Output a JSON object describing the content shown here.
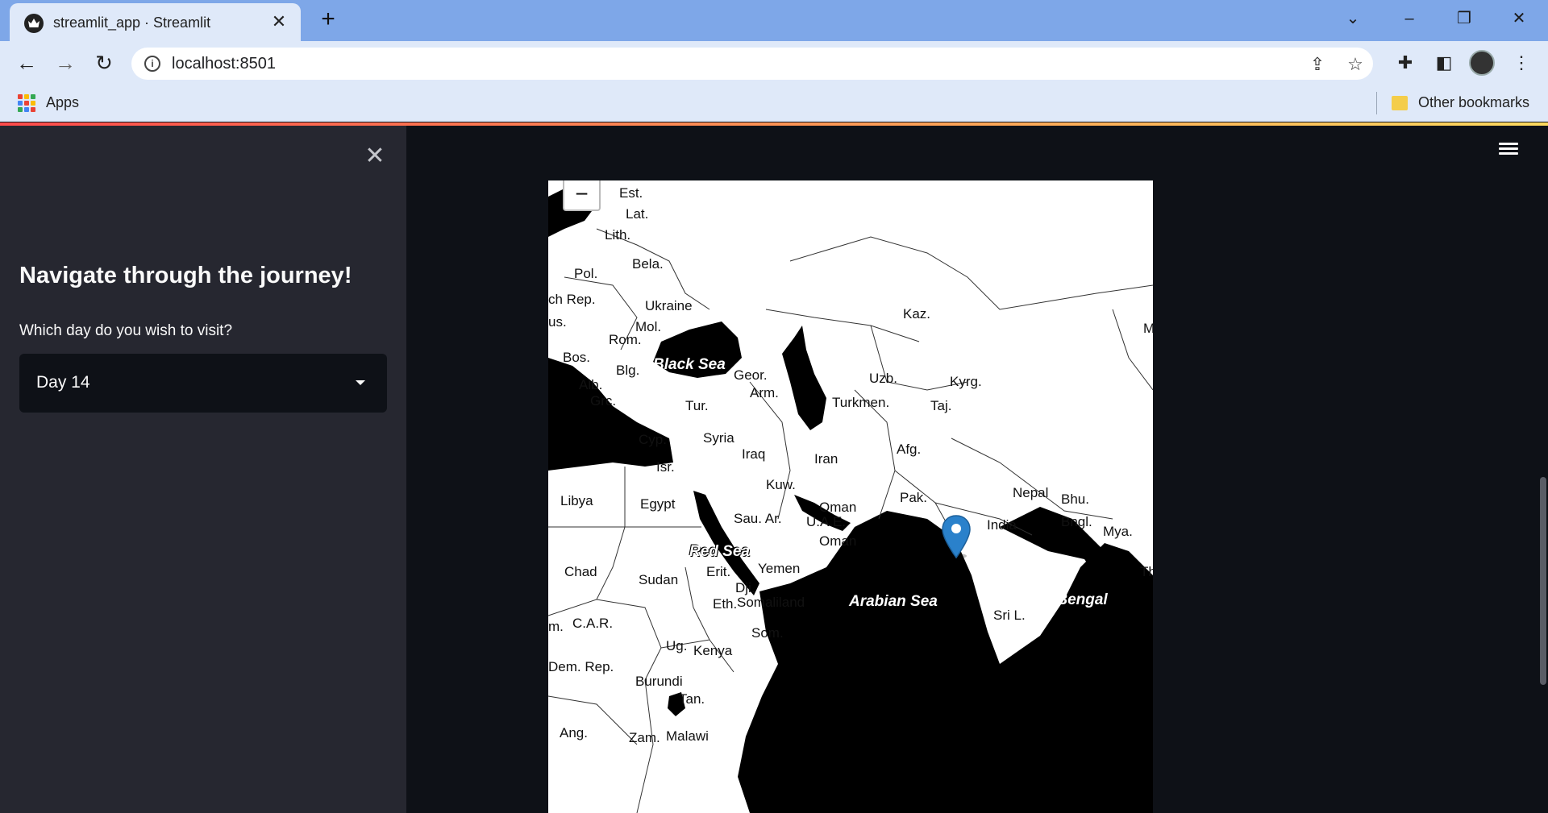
{
  "browser": {
    "tab_title": "streamlit_app · Streamlit",
    "new_tab_label": "+",
    "url": "localhost:8501",
    "bookmarks": {
      "apps_label": "Apps",
      "other_label": "Other bookmarks"
    }
  },
  "sidebar": {
    "close_glyph": "✕",
    "heading": "Navigate through the journey!",
    "select_label": "Which day do you wish to visit?",
    "select_value": "Day 14"
  },
  "map": {
    "zoom_out_glyph": "−",
    "country_labels": [
      "Est.",
      "Lat.",
      "Lith.",
      "Bela.",
      "Pol.",
      "ch Rep.",
      "Ukraine",
      "us.",
      "Mol.",
      "Rom.",
      "Bos.",
      "Blg.",
      "Alb.",
      "Grc.",
      "Geor.",
      "Arm.",
      "Tur.",
      "Kaz.",
      "Uzb.",
      "Kyrg.",
      "Turkmen.",
      "Taj.",
      "M",
      "Cyp.",
      "Syria",
      "Isr.",
      "Iraq",
      "Iran",
      "Afg.",
      "Libya",
      "Egypt",
      "Kuw.",
      "Oman",
      "U.A.E.",
      "Pak.",
      "Nepal",
      "Bhu.",
      "Sau. Ar.",
      "India",
      "Bngl.",
      "Mya.",
      "Oman",
      "Chad",
      "Sudan",
      "Erit.",
      "Yemen",
      "Tha",
      "Dji.",
      "Somaliland",
      "Eth.",
      "Sri L.",
      "m.",
      "C.A.R.",
      "Som.",
      "Ug.",
      "Kenya",
      "Dem. Rep.",
      "Burundi",
      "Tan.",
      "Ang.",
      "Zam.",
      "Malawi"
    ],
    "sea_labels": [
      "Black Sea",
      "Red Sea",
      "Arabian Sea",
      "Bay of Bengal"
    ],
    "marker_location": "India"
  },
  "colors": {
    "app_bg": "#0e1117",
    "sidebar_bg": "#262730",
    "marker": "#2a81cb",
    "decoration_start": "#ff4b4b",
    "decoration_end": "#fdda5e"
  }
}
